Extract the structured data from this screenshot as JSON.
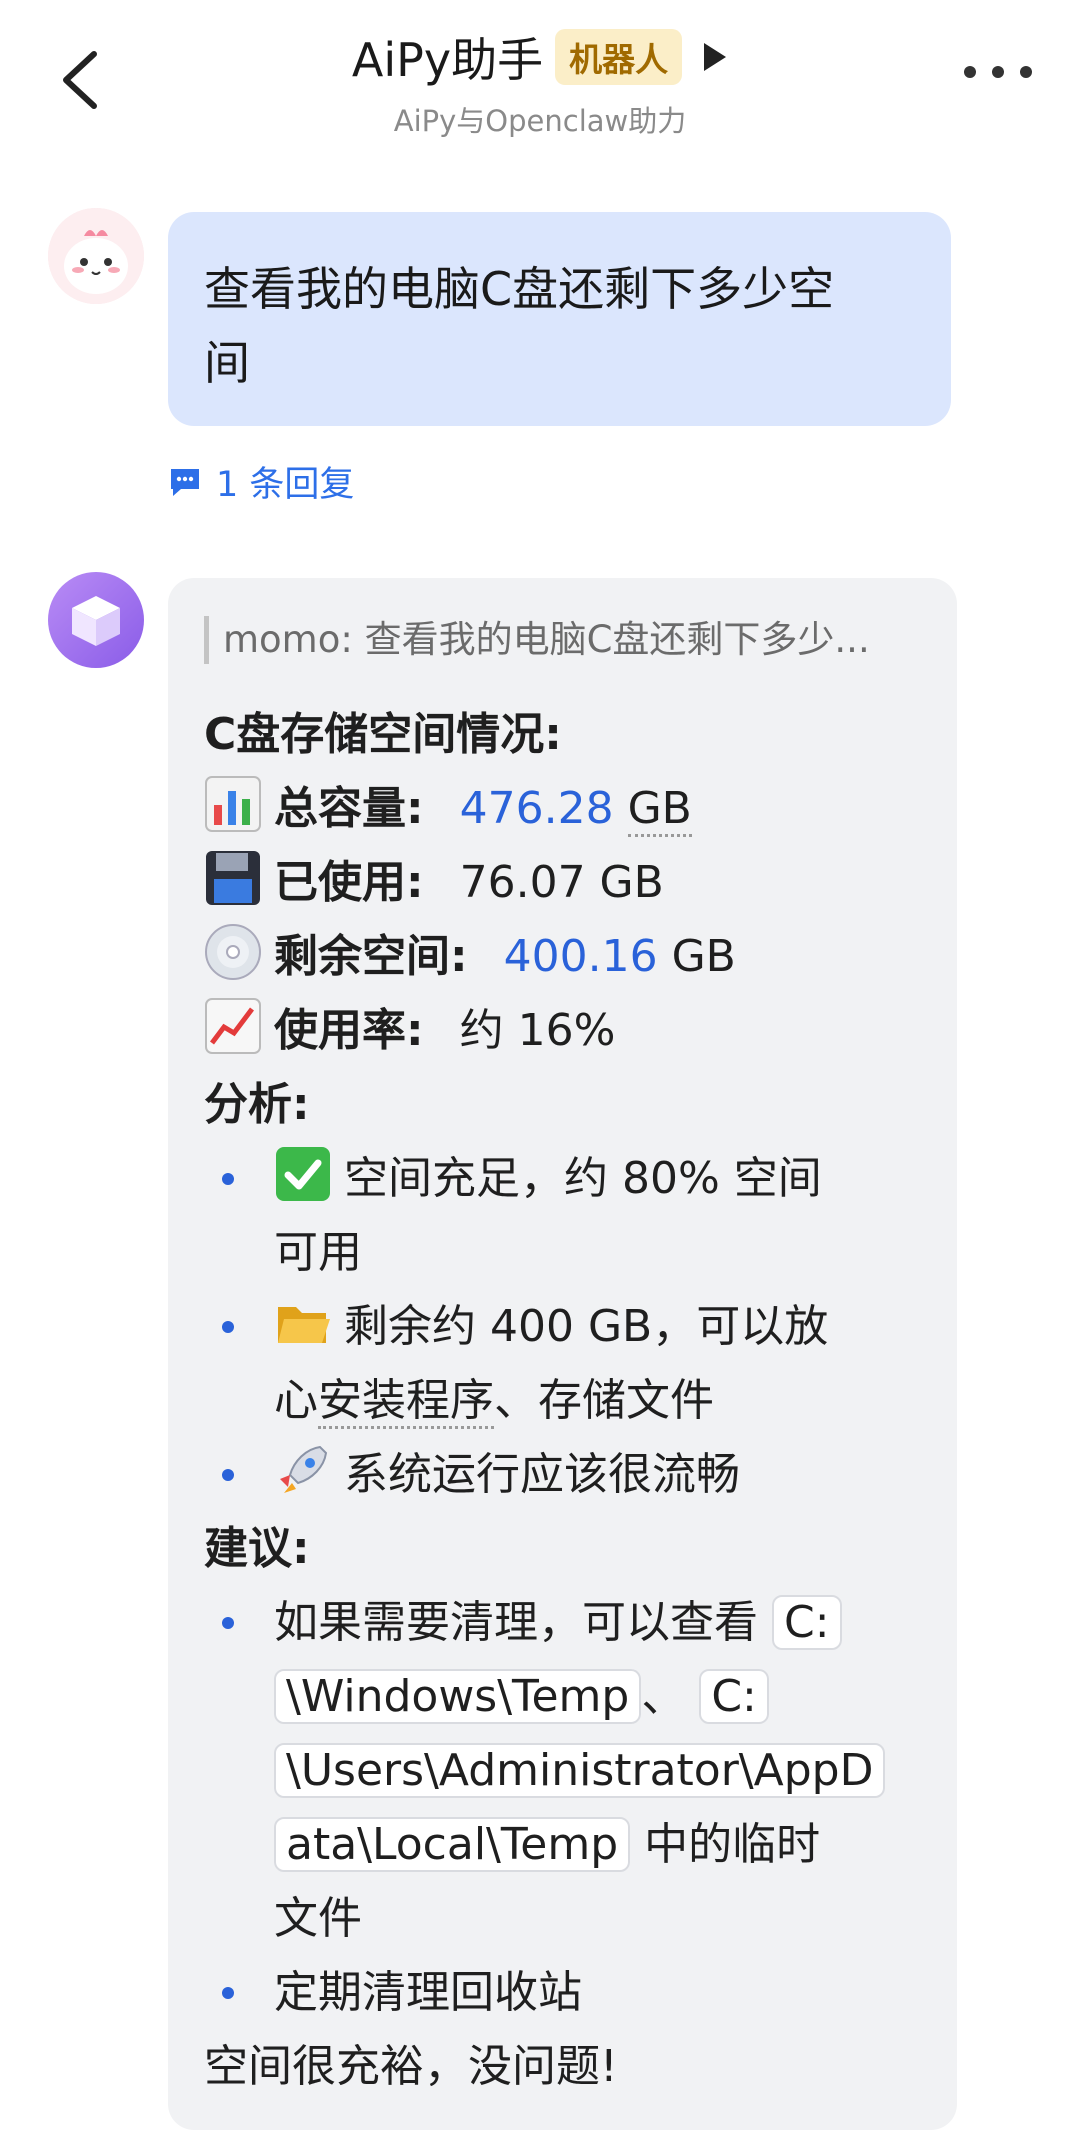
{
  "header": {
    "title": "AiPy助手",
    "badge": "机器人",
    "subtitle": "AiPy与Openclaw助力"
  },
  "user_message": {
    "text_line1": "查看我的电脑C盘还剩下多少空",
    "text_line2": "间",
    "reply_count": "1 条回复"
  },
  "bot_message": {
    "quote": "momo: 查看我的电脑C盘还剩下多少...",
    "heading": "C盘存储空间情况:",
    "stats": [
      {
        "icon": "bar-chart-icon",
        "label": "总容量:",
        "value": "476.28",
        "unit": "GB"
      },
      {
        "icon": "floppy-disk-icon",
        "label": "已使用:",
        "value": "76.07 GB"
      },
      {
        "icon": "disc-icon",
        "label": "剩余空间:",
        "value": "400.16",
        "unit": "GB"
      },
      {
        "icon": "trend-up-icon",
        "label": "使用率:",
        "value": "约 16%"
      }
    ],
    "analysis_title": "分析:",
    "analysis": [
      {
        "line1": "空间充足，约 80% 空间",
        "line2": "可用"
      },
      {
        "line1": "剩余约 400 GB，可以放",
        "line2a": "心",
        "line2b": "安装程序",
        "line2c": "、存储文件"
      },
      {
        "line1": "系统运行应该很流畅"
      }
    ],
    "advice_title": "建议:",
    "advice": {
      "prefix": "如果需要清理，可以查看",
      "code1_a": "C:",
      "code1_b": "\\Windows\\Temp",
      "sep": "、",
      "code2_a": "C:",
      "code2_b": "\\Users\\Administrator\\AppD",
      "code2_c": "ata\\Local\\Temp",
      "suffix": "中的临时",
      "suffix2": "文件",
      "item2": "定期清理回收站"
    },
    "closing": "空间很充裕，没问题!"
  }
}
